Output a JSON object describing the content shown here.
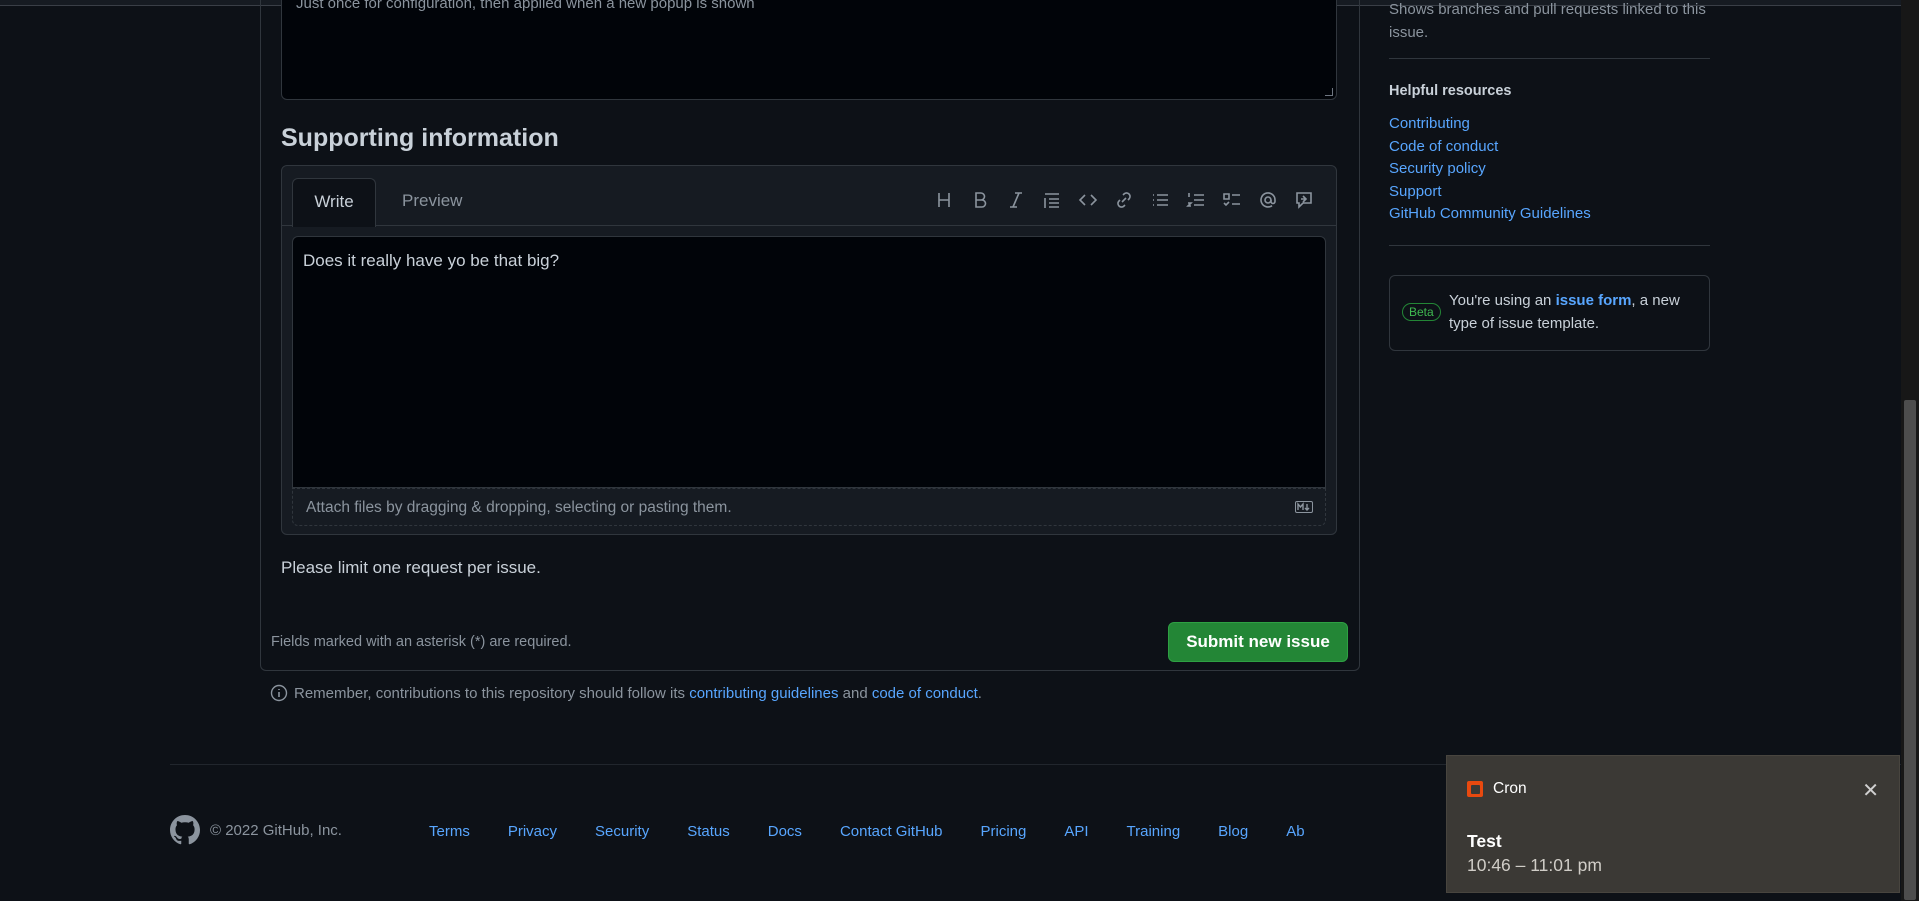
{
  "form": {
    "previous_text": "Just once for configuration, then applied when a new popup is shown",
    "section_title": "Supporting information",
    "tabs": {
      "write": "Write",
      "preview": "Preview"
    },
    "toolbar": [
      "heading-icon",
      "bold-icon",
      "italic-icon",
      "quote-icon",
      "code-icon",
      "link-icon",
      "unordered-list-icon",
      "ordered-list-icon",
      "task-list-icon",
      "mention-icon",
      "reference-icon"
    ],
    "textarea_value": "Does it really have yo be that big?",
    "attach_hint": "Attach files by dragging & dropping, selecting or pasting them.",
    "limit_text": "Please limit one request per issue.",
    "required_text": "Fields marked with an asterisk (*) are required.",
    "submit_label": "Submit new issue",
    "remember_prefix": "Remember, contributions to this repository should follow its ",
    "contributing_link": "contributing guidelines",
    "and_text": " and ",
    "coc_link": "code of conduct",
    "period": "."
  },
  "sidebar": {
    "linked_text": "Shows branches and pull requests linked to this issue.",
    "helpful_heading": "Helpful resources",
    "links": [
      "Contributing",
      "Code of conduct",
      "Security policy",
      "Support",
      "GitHub Community Guidelines"
    ],
    "beta_badge": "Beta",
    "beta_prefix": "You're using an ",
    "beta_link": "issue form",
    "beta_suffix": ", a new type of issue template."
  },
  "footer": {
    "copyright": "© 2022 GitHub, Inc.",
    "links": [
      "Terms",
      "Privacy",
      "Security",
      "Status",
      "Docs",
      "Contact GitHub",
      "Pricing",
      "API",
      "Training",
      "Blog",
      "Ab"
    ]
  },
  "toast": {
    "app": "Cron",
    "title": "Test",
    "time": "10:46 – 11:01 pm",
    "close_icon": "close-icon"
  },
  "colors": {
    "background": "#0d1117",
    "link": "#58a6ff",
    "submit": "#238636",
    "toast_bg": "#3b3935"
  }
}
